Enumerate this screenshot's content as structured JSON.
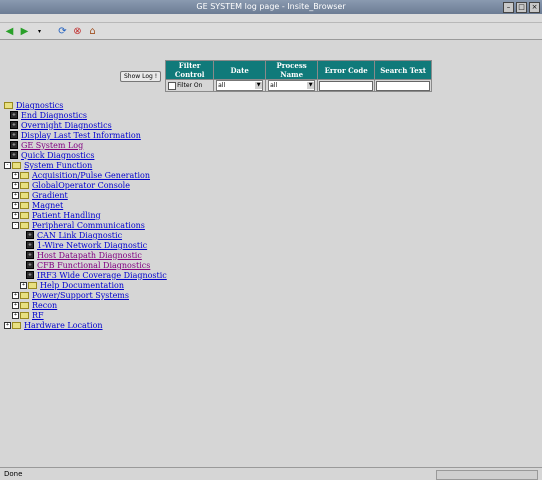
{
  "window": {
    "title": "GE SYSTEM log page - Insite_Browser"
  },
  "toolbar": {
    "back_icon": "back-arrow-icon",
    "forward_icon": "forward-arrow-icon",
    "reload_icon": "reload-icon",
    "stop_icon": "stop-icon",
    "home_icon": "home-icon"
  },
  "controls": {
    "show_log_label": "Show Log !",
    "filter_header": "Filter Control",
    "filter_label": "Filter On",
    "date_header": "Date",
    "date_value": "all",
    "process_header": "Process Name",
    "process_value": "all",
    "error_header": "Error Code",
    "search_header": "Search Text"
  },
  "tree": {
    "diagnostics": "Diagnostics",
    "end_diag": "End Diagnostics",
    "overnight": "Overnight Diagnostics",
    "last_test": "Display Last Test Information",
    "ge_log": "GE System Log",
    "quick": "Quick Diagnostics",
    "system_function": "System Function",
    "acq": "Acquisition/Pulse Generation",
    "global": "GlobalOperator Console",
    "gradient": "Gradient",
    "magnet": "Magnet",
    "patient": "Patient Handling",
    "peripheral": "Peripheral Communications",
    "can": "CAN Link Diagnostic",
    "onewire": "1-Wire Network Diagnostic",
    "host": "Host Datapath Diagnostic",
    "cfb": "CFB Functional Diagnostics",
    "irf3": "IRF3 Wide Coverage Diagnostic",
    "help": "Help Documentation",
    "power": "Power/Support Systems",
    "recon": "Recon",
    "rf": "RF",
    "hardware": "Hardware Location"
  },
  "status": {
    "text": "Done"
  },
  "colors": {
    "header_teal": "#107a7a",
    "link": "#0000cc",
    "visited": "#800080"
  }
}
